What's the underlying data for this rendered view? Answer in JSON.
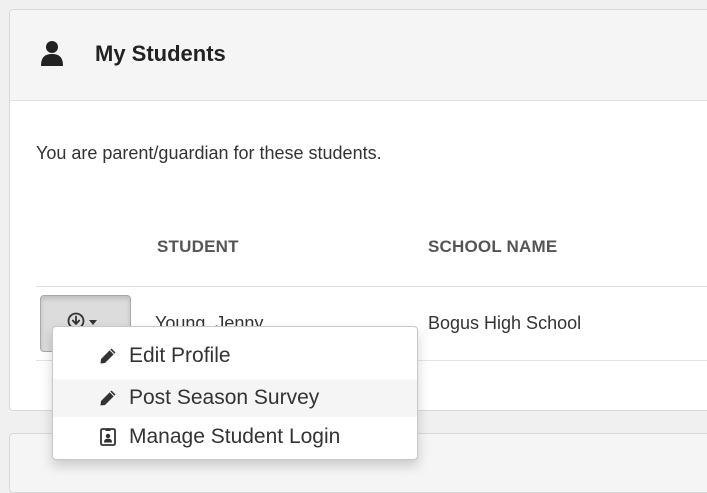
{
  "panel": {
    "title": "My Students",
    "title_icon": "user-icon",
    "intro": "You are parent/guardian for these students."
  },
  "table": {
    "columns": [
      "STUDENT",
      "SCHOOL NAME"
    ],
    "rows": [
      {
        "student": "Young, Jenny",
        "school": "Bogus High School"
      }
    ]
  },
  "actions_button": {
    "icon": "circle-arrow-down-icon",
    "caret": "caret-down-icon"
  },
  "dropdown": {
    "items": [
      {
        "label": "Edit Profile",
        "icon": "pencil-icon",
        "hovered": false
      },
      {
        "label": "Post Season Survey",
        "icon": "pencil-icon",
        "hovered": true
      },
      {
        "label": "Manage Student Login",
        "icon": "id-badge-icon",
        "hovered": false
      }
    ]
  },
  "colors": {
    "page_bg": "#f0f0f0",
    "panel_heading_bg": "#f5f5f5",
    "button_bg": "#dcdcdc",
    "menu_hover_bg": "#f5f5f5",
    "text": "#333333"
  }
}
